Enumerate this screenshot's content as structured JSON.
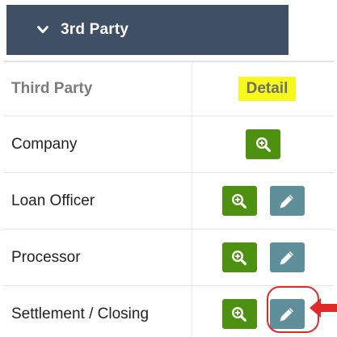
{
  "section": {
    "title": "3rd Party",
    "icon": "chevron-down-icon"
  },
  "table": {
    "header": {
      "name": "Third Party",
      "detail": "Detail",
      "detail_highlight_color": "#f6f91a"
    },
    "rows": [
      {
        "name": "Company",
        "actions": [
          "zoom-icon"
        ]
      },
      {
        "name": "Loan Officer",
        "actions": [
          "zoom-icon",
          "pencil-icon"
        ]
      },
      {
        "name": "Processor",
        "actions": [
          "zoom-icon",
          "pencil-icon"
        ]
      },
      {
        "name": "Settlement / Closing",
        "actions": [
          "zoom-icon",
          "pencil-icon"
        ]
      }
    ]
  },
  "colors": {
    "header_bg": "#3e4f66",
    "view_button": "#4e900f",
    "edit_button": "#5e8f9a",
    "annotation": "#e02b2b"
  }
}
